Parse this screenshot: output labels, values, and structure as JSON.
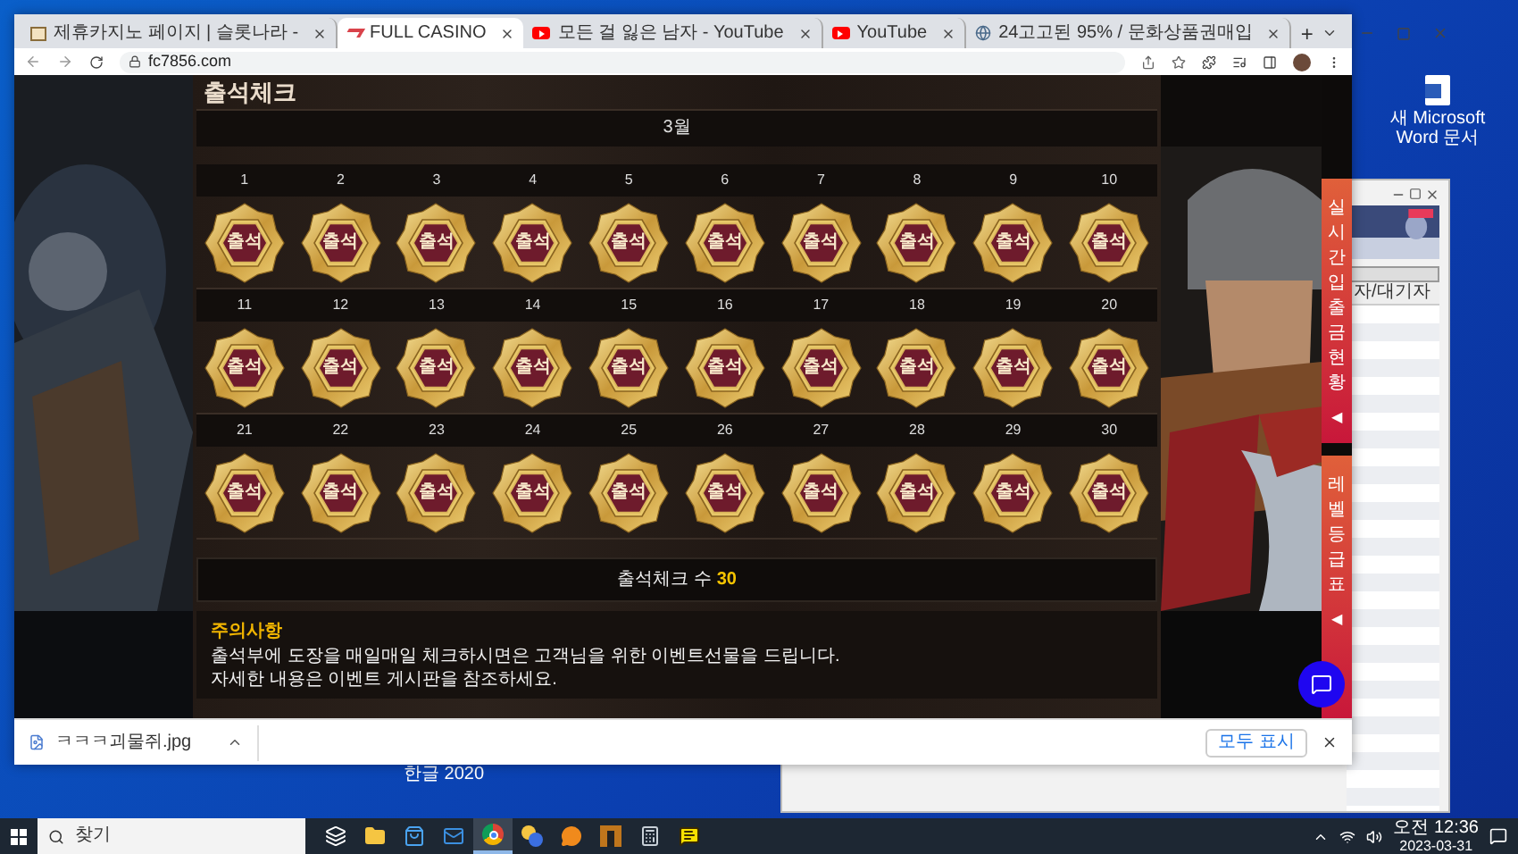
{
  "desktop": {
    "icon_label": "새 Microsoft Word 문서",
    "cut_label": "한글 2020"
  },
  "browser": {
    "tabs": [
      {
        "title": "제휴카지노 페이지 | 슬롯나라 -",
        "kind": "page",
        "selected": false
      },
      {
        "title": "FULL CASINO",
        "kind": "casino",
        "selected": true
      },
      {
        "title": "모든 걸 잃은 남자 - YouTube",
        "kind": "youtube",
        "selected": false
      },
      {
        "title": "YouTube",
        "kind": "youtube",
        "selected": false
      },
      {
        "title": "24고고된 95% / 문화상품권매입",
        "kind": "globe",
        "selected": false
      }
    ],
    "new_tab": "+",
    "url": "fc7856.com"
  },
  "page": {
    "title": "출석체크",
    "month": "3월",
    "days": [
      {
        "day": "1",
        "stamp": "출석",
        "checked": true
      },
      {
        "day": "2",
        "stamp": "출석",
        "checked": true
      },
      {
        "day": "3",
        "stamp": "출석",
        "checked": true
      },
      {
        "day": "4",
        "stamp": "출석",
        "checked": true
      },
      {
        "day": "5",
        "stamp": "출석",
        "checked": true
      },
      {
        "day": "6",
        "stamp": "출석",
        "checked": true
      },
      {
        "day": "7",
        "stamp": "출석",
        "checked": true
      },
      {
        "day": "8",
        "stamp": "출석",
        "checked": true
      },
      {
        "day": "9",
        "stamp": "출석",
        "checked": true
      },
      {
        "day": "10",
        "stamp": "출석",
        "checked": true
      },
      {
        "day": "11",
        "stamp": "출석",
        "checked": true
      },
      {
        "day": "12",
        "stamp": "출석",
        "checked": true
      },
      {
        "day": "13",
        "stamp": "출석",
        "checked": true
      },
      {
        "day": "14",
        "stamp": "출석",
        "checked": true
      },
      {
        "day": "15",
        "stamp": "출석",
        "checked": true
      },
      {
        "day": "16",
        "stamp": "출석",
        "checked": true
      },
      {
        "day": "17",
        "stamp": "출석",
        "checked": true
      },
      {
        "day": "18",
        "stamp": "출석",
        "checked": true
      },
      {
        "day": "19",
        "stamp": "출석",
        "checked": true
      },
      {
        "day": "20",
        "stamp": "출석",
        "checked": true
      },
      {
        "day": "21",
        "stamp": "출석",
        "checked": true
      },
      {
        "day": "22",
        "stamp": "출석",
        "checked": true
      },
      {
        "day": "23",
        "stamp": "출석",
        "checked": true
      },
      {
        "day": "24",
        "stamp": "출석",
        "checked": true
      },
      {
        "day": "25",
        "stamp": "출석",
        "checked": true
      },
      {
        "day": "26",
        "stamp": "출석",
        "checked": true
      },
      {
        "day": "27",
        "stamp": "출석",
        "checked": true
      },
      {
        "day": "28",
        "stamp": "출석",
        "checked": true
      },
      {
        "day": "29",
        "stamp": "출석",
        "checked": true
      },
      {
        "day": "30",
        "stamp": "출석",
        "checked": true
      }
    ],
    "count": {
      "label": "출석체크 수",
      "value": "30"
    },
    "notice": {
      "title": "주의사항",
      "lines": [
        "출석부에 도장을 매일매일 체크하시면은 고객님을 위한 이벤트선물을 드립니다.",
        "자세한 내용은 이벤트 게시판을 참조하세요."
      ]
    },
    "side_tabs": [
      {
        "label": "실시간입출금현황",
        "arrow": "◀"
      },
      {
        "label": "레벨등급표",
        "arrow": "◀"
      }
    ]
  },
  "download_bar": {
    "file": "ㅋㅋㅋ괴물쥐.jpg",
    "show_all": "모두 표시"
  },
  "back_window": {
    "column": "자/대기자"
  },
  "taskbar": {
    "search": "찾기",
    "apps": [
      {
        "kind": "taskview",
        "selected": false
      },
      {
        "kind": "folder",
        "selected": false
      },
      {
        "kind": "store",
        "selected": false
      },
      {
        "kind": "mail",
        "selected": false
      },
      {
        "kind": "chrome",
        "selected": true
      },
      {
        "kind": "bubbles",
        "selected": false
      },
      {
        "kind": "chat",
        "selected": false
      },
      {
        "kind": "app",
        "selected": false
      },
      {
        "kind": "calculator",
        "selected": false
      },
      {
        "kind": "talk",
        "selected": false
      }
    ],
    "time": "오전 12:36",
    "date": "2023-03-31"
  }
}
